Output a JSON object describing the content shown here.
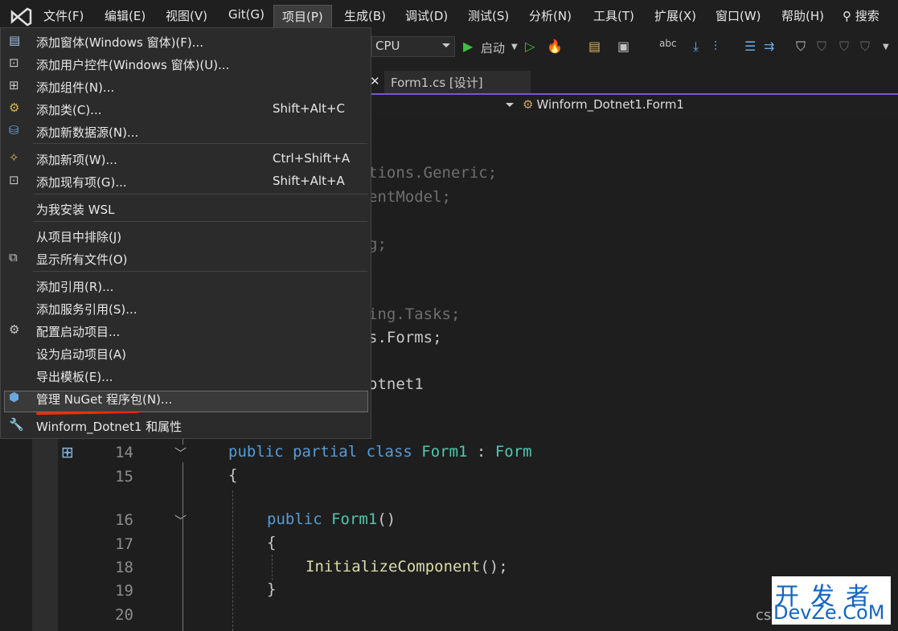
{
  "menubar": {
    "items": [
      "文件(F)",
      "编辑(E)",
      "视图(V)",
      "Git(G)",
      "项目(P)",
      "生成(B)",
      "调试(D)",
      "测试(S)",
      "分析(N)",
      "工具(T)",
      "扩展(X)",
      "窗口(W)",
      "帮助(H)"
    ],
    "search": "搜索"
  },
  "toolbar": {
    "platform": "CPU",
    "start_label": "启动"
  },
  "tabs": {
    "design_tab": "Form1.cs [设计]"
  },
  "navbar": {
    "class_name": "Winform_Dotnet1.Form1"
  },
  "project_menu": {
    "items": [
      {
        "label": "添加窗体(Windows 窗体)(F)...",
        "shortcut": ""
      },
      {
        "label": "添加用户控件(Windows 窗体)(U)...",
        "shortcut": ""
      },
      {
        "label": "添加组件(N)...",
        "shortcut": ""
      },
      {
        "label": "添加类(C)...",
        "shortcut": "Shift+Alt+C"
      },
      {
        "label": "添加新数据源(N)...",
        "shortcut": ""
      },
      {
        "label": "添加新项(W)...",
        "shortcut": "Ctrl+Shift+A"
      },
      {
        "label": "添加现有项(G)...",
        "shortcut": "Shift+Alt+A"
      },
      {
        "label": "为我安装 WSL",
        "shortcut": ""
      },
      {
        "label": "从项目中排除(J)",
        "shortcut": ""
      },
      {
        "label": "显示所有文件(O)",
        "shortcut": ""
      },
      {
        "label": "添加引用(R)...",
        "shortcut": ""
      },
      {
        "label": "添加服务引用(S)...",
        "shortcut": ""
      },
      {
        "label": "配置启动项目...",
        "shortcut": ""
      },
      {
        "label": "设为启动项目(A)",
        "shortcut": ""
      },
      {
        "label": "导出模板(E)...",
        "shortcut": ""
      },
      {
        "label": "管理 NuGet 程序包(N)...",
        "shortcut": ""
      },
      {
        "label": "Winform_Dotnet1 和属性",
        "shortcut": ""
      }
    ]
  },
  "code": {
    "partial_lines": [
      "tions.Generic;",
      "entModel;",
      "g;",
      "ing.Tasks;",
      "s.Forms;",
      "otnet1"
    ],
    "line_numbers": [
      "14",
      "15",
      "16",
      "17",
      "18",
      "19",
      "20"
    ],
    "line14": {
      "kw1": "public",
      "kw2": "partial",
      "kw3": "class",
      "name": "Form1",
      "colon": " : ",
      "base": "Form"
    },
    "line15": "{",
    "line16": {
      "kw": "public",
      "name": "Form1",
      "parens": "()"
    },
    "line17": "{",
    "line18": {
      "call": "InitializeComponent",
      "rest": "();"
    },
    "line19": "}"
  },
  "watermark": {
    "top": "开发者",
    "bottom": "DevZe.CoM",
    "prefix": "cs"
  }
}
